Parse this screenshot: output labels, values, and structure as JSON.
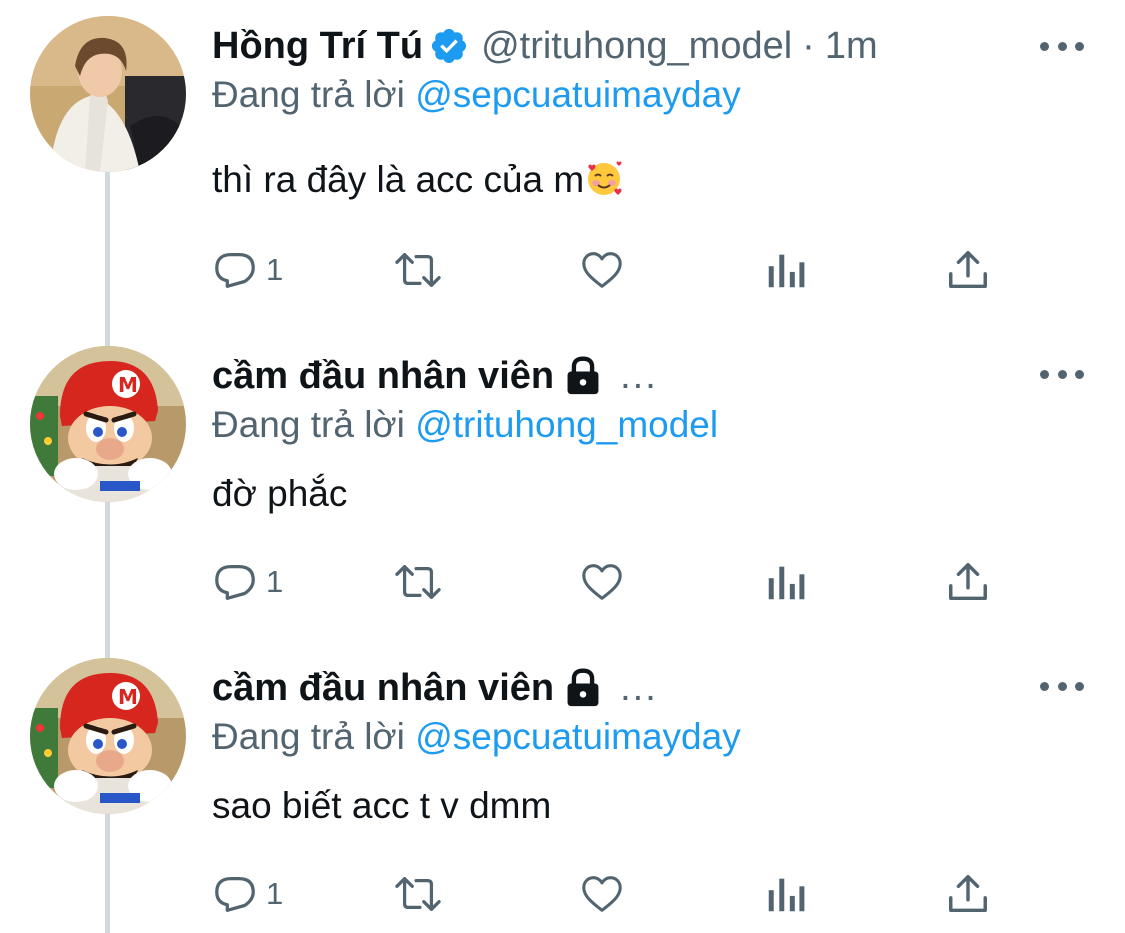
{
  "colors": {
    "accent": "#1d9bf0",
    "secondary_text": "#536471",
    "primary_text": "#0f1419",
    "thread_line": "#cfd9de"
  },
  "tweets": [
    {
      "display_name": "Hồng Trí Tú",
      "verified": true,
      "handle": "@trituhong_model",
      "separator": "·",
      "time": "1m",
      "reply_prefix": "Đang trả lời",
      "reply_to": "@sepcuatuimayday",
      "text": "thì ra đây là acc của m",
      "emoji": "smiling-face-with-hearts",
      "reply_count": "1",
      "avatar": "person-portrait"
    },
    {
      "display_name": "cầm đầu nhân viên",
      "protected": true,
      "truncated_mark": "...",
      "reply_prefix": "Đang trả lời",
      "reply_to": "@trituhong_model",
      "text": "đờ phắc",
      "reply_count": "1",
      "avatar": "mario-typing"
    },
    {
      "display_name": "cầm đầu nhân viên",
      "protected": true,
      "truncated_mark": "...",
      "reply_prefix": "Đang trả lời",
      "reply_to": "@sepcuatuimayday",
      "text": "sao biết acc t v dmm",
      "reply_count": "1",
      "avatar": "mario-typing"
    }
  ],
  "icons": [
    "reply-icon",
    "retweet-icon",
    "like-icon",
    "analytics-icon",
    "share-icon",
    "more-icon",
    "verified-badge-icon",
    "lock-icon"
  ]
}
